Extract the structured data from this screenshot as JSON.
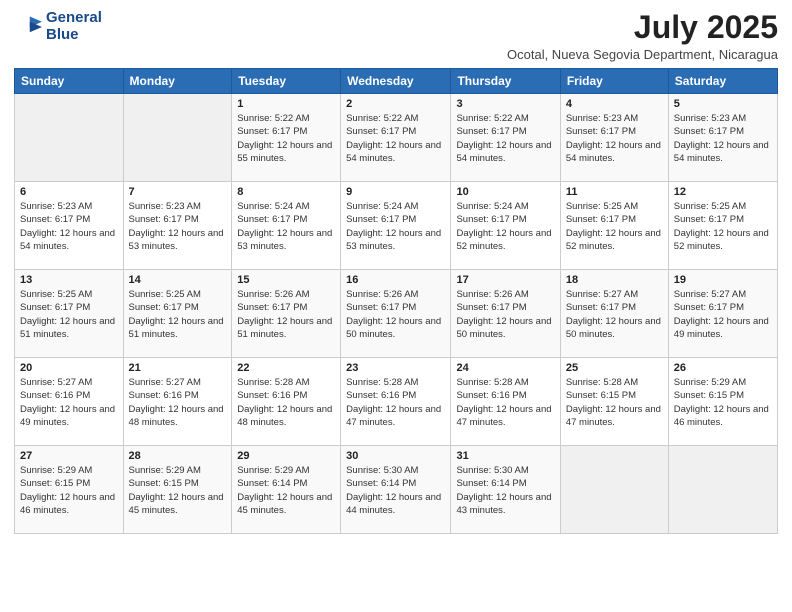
{
  "logo": {
    "line1": "General",
    "line2": "Blue"
  },
  "title": "July 2025",
  "subtitle": "Ocotal, Nueva Segovia Department, Nicaragua",
  "weekdays": [
    "Sunday",
    "Monday",
    "Tuesday",
    "Wednesday",
    "Thursday",
    "Friday",
    "Saturday"
  ],
  "weeks": [
    [
      {
        "day": "",
        "info": ""
      },
      {
        "day": "",
        "info": ""
      },
      {
        "day": "1",
        "info": "Sunrise: 5:22 AM\nSunset: 6:17 PM\nDaylight: 12 hours and 55 minutes."
      },
      {
        "day": "2",
        "info": "Sunrise: 5:22 AM\nSunset: 6:17 PM\nDaylight: 12 hours and 54 minutes."
      },
      {
        "day": "3",
        "info": "Sunrise: 5:22 AM\nSunset: 6:17 PM\nDaylight: 12 hours and 54 minutes."
      },
      {
        "day": "4",
        "info": "Sunrise: 5:23 AM\nSunset: 6:17 PM\nDaylight: 12 hours and 54 minutes."
      },
      {
        "day": "5",
        "info": "Sunrise: 5:23 AM\nSunset: 6:17 PM\nDaylight: 12 hours and 54 minutes."
      }
    ],
    [
      {
        "day": "6",
        "info": "Sunrise: 5:23 AM\nSunset: 6:17 PM\nDaylight: 12 hours and 54 minutes."
      },
      {
        "day": "7",
        "info": "Sunrise: 5:23 AM\nSunset: 6:17 PM\nDaylight: 12 hours and 53 minutes."
      },
      {
        "day": "8",
        "info": "Sunrise: 5:24 AM\nSunset: 6:17 PM\nDaylight: 12 hours and 53 minutes."
      },
      {
        "day": "9",
        "info": "Sunrise: 5:24 AM\nSunset: 6:17 PM\nDaylight: 12 hours and 53 minutes."
      },
      {
        "day": "10",
        "info": "Sunrise: 5:24 AM\nSunset: 6:17 PM\nDaylight: 12 hours and 52 minutes."
      },
      {
        "day": "11",
        "info": "Sunrise: 5:25 AM\nSunset: 6:17 PM\nDaylight: 12 hours and 52 minutes."
      },
      {
        "day": "12",
        "info": "Sunrise: 5:25 AM\nSunset: 6:17 PM\nDaylight: 12 hours and 52 minutes."
      }
    ],
    [
      {
        "day": "13",
        "info": "Sunrise: 5:25 AM\nSunset: 6:17 PM\nDaylight: 12 hours and 51 minutes."
      },
      {
        "day": "14",
        "info": "Sunrise: 5:25 AM\nSunset: 6:17 PM\nDaylight: 12 hours and 51 minutes."
      },
      {
        "day": "15",
        "info": "Sunrise: 5:26 AM\nSunset: 6:17 PM\nDaylight: 12 hours and 51 minutes."
      },
      {
        "day": "16",
        "info": "Sunrise: 5:26 AM\nSunset: 6:17 PM\nDaylight: 12 hours and 50 minutes."
      },
      {
        "day": "17",
        "info": "Sunrise: 5:26 AM\nSunset: 6:17 PM\nDaylight: 12 hours and 50 minutes."
      },
      {
        "day": "18",
        "info": "Sunrise: 5:27 AM\nSunset: 6:17 PM\nDaylight: 12 hours and 50 minutes."
      },
      {
        "day": "19",
        "info": "Sunrise: 5:27 AM\nSunset: 6:17 PM\nDaylight: 12 hours and 49 minutes."
      }
    ],
    [
      {
        "day": "20",
        "info": "Sunrise: 5:27 AM\nSunset: 6:16 PM\nDaylight: 12 hours and 49 minutes."
      },
      {
        "day": "21",
        "info": "Sunrise: 5:27 AM\nSunset: 6:16 PM\nDaylight: 12 hours and 48 minutes."
      },
      {
        "day": "22",
        "info": "Sunrise: 5:28 AM\nSunset: 6:16 PM\nDaylight: 12 hours and 48 minutes."
      },
      {
        "day": "23",
        "info": "Sunrise: 5:28 AM\nSunset: 6:16 PM\nDaylight: 12 hours and 47 minutes."
      },
      {
        "day": "24",
        "info": "Sunrise: 5:28 AM\nSunset: 6:16 PM\nDaylight: 12 hours and 47 minutes."
      },
      {
        "day": "25",
        "info": "Sunrise: 5:28 AM\nSunset: 6:15 PM\nDaylight: 12 hours and 47 minutes."
      },
      {
        "day": "26",
        "info": "Sunrise: 5:29 AM\nSunset: 6:15 PM\nDaylight: 12 hours and 46 minutes."
      }
    ],
    [
      {
        "day": "27",
        "info": "Sunrise: 5:29 AM\nSunset: 6:15 PM\nDaylight: 12 hours and 46 minutes."
      },
      {
        "day": "28",
        "info": "Sunrise: 5:29 AM\nSunset: 6:15 PM\nDaylight: 12 hours and 45 minutes."
      },
      {
        "day": "29",
        "info": "Sunrise: 5:29 AM\nSunset: 6:14 PM\nDaylight: 12 hours and 45 minutes."
      },
      {
        "day": "30",
        "info": "Sunrise: 5:30 AM\nSunset: 6:14 PM\nDaylight: 12 hours and 44 minutes."
      },
      {
        "day": "31",
        "info": "Sunrise: 5:30 AM\nSunset: 6:14 PM\nDaylight: 12 hours and 43 minutes."
      },
      {
        "day": "",
        "info": ""
      },
      {
        "day": "",
        "info": ""
      }
    ]
  ]
}
